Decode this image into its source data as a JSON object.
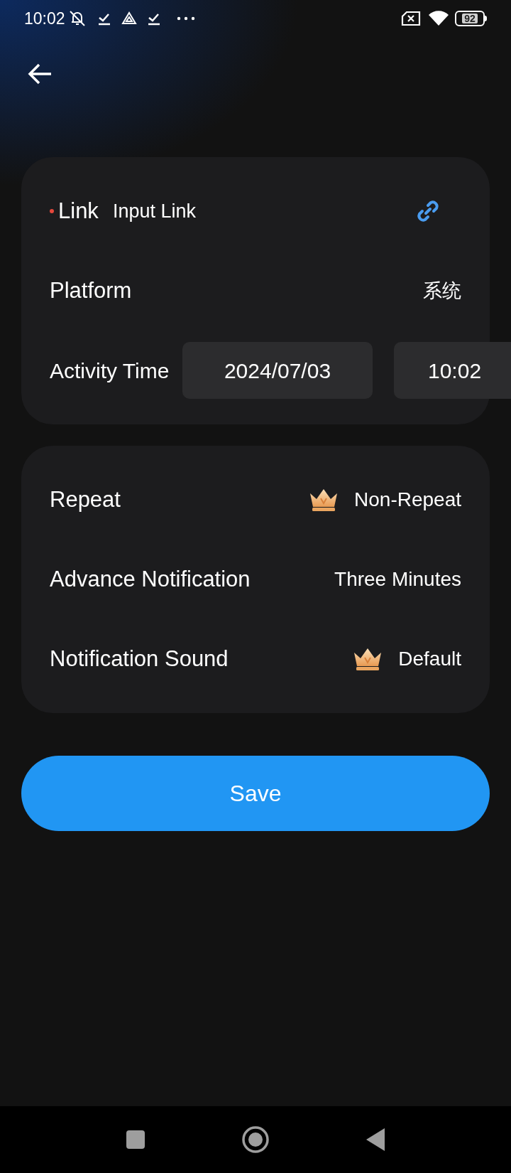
{
  "status_bar": {
    "time": "10:02",
    "battery": "92"
  },
  "link": {
    "label": "Link",
    "required": true,
    "placeholder": "Input Link"
  },
  "platform": {
    "label": "Platform",
    "value": "系统"
  },
  "activity_time": {
    "label": "Activity Time",
    "date": "2024/07/03",
    "time": "10:02"
  },
  "settings": [
    {
      "label": "Repeat",
      "value": "Non-Repeat",
      "premium": true
    },
    {
      "label": "Advance Notification",
      "value": "Three Minutes",
      "premium": false
    },
    {
      "label": "Notification Sound",
      "value": "Default",
      "premium": true
    }
  ],
  "save_button": "Save"
}
